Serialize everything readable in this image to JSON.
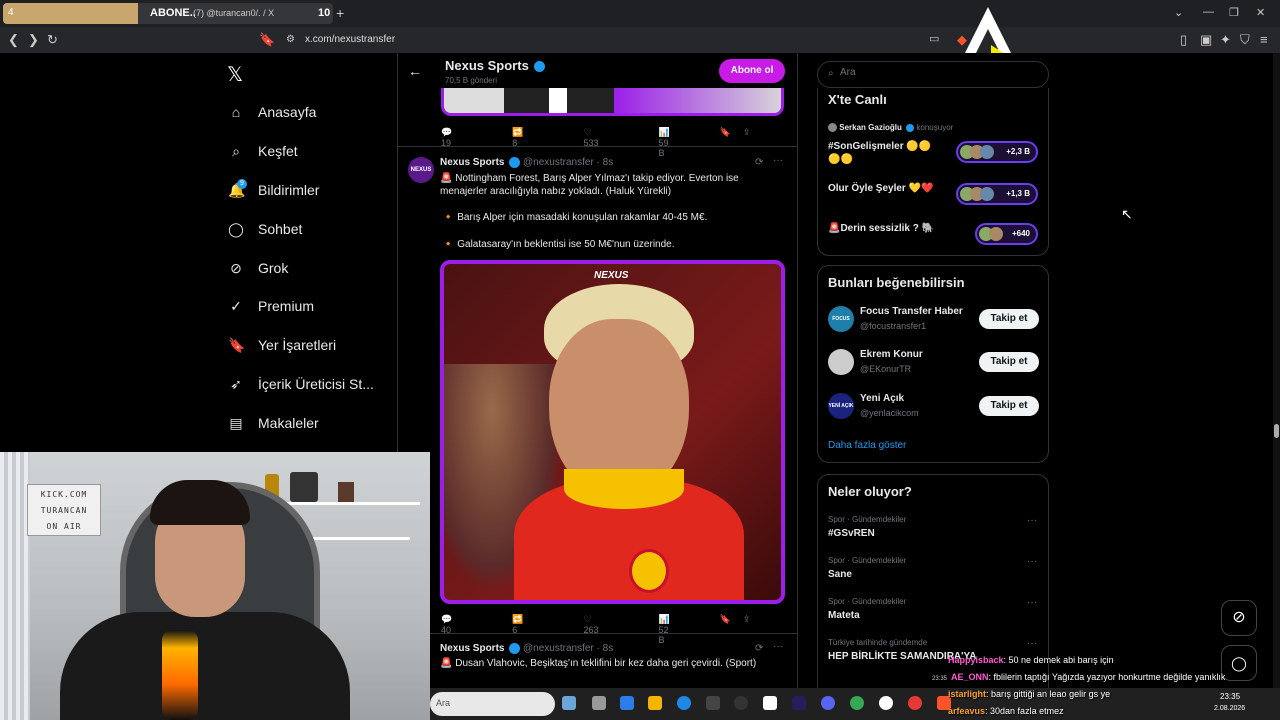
{
  "browser": {
    "tab_number": "4",
    "tab_title": "ABONE..",
    "tab_subtitle": "(7) @turancan0/. / X",
    "tab_count": "10",
    "new_tab": "+",
    "url": "x.com/nexustransfer",
    "tab_progress": 0.41
  },
  "nav": {
    "logo": "𝕏",
    "items": [
      {
        "label": "Anasayfa",
        "icon": "home-icon"
      },
      {
        "label": "Keşfet",
        "icon": "search-icon"
      },
      {
        "label": "Bildirimler",
        "icon": "bell-icon"
      },
      {
        "label": "Sohbet",
        "icon": "chat-icon"
      },
      {
        "label": "Grok",
        "icon": "grok-icon"
      },
      {
        "label": "Premium",
        "icon": "premium-icon"
      },
      {
        "label": "Yer İşaretleri",
        "icon": "bookmark-icon"
      },
      {
        "label": "İçerik Üreticisi St...",
        "icon": "rocket-icon"
      },
      {
        "label": "Makaleler",
        "icon": "article-icon"
      }
    ],
    "notif_badge": "9"
  },
  "profile_header": {
    "name": "Nexus Sports",
    "posts": "70,5 B gönderi",
    "subscribe": "Abone ol"
  },
  "tweet1_actions": {
    "replies": "19",
    "retweets": "8",
    "likes": "533",
    "views": "59 B"
  },
  "tweet2": {
    "name": "Nexus Sports",
    "handle": "@nexustransfer · 8s",
    "text1": "🚨 Nottingham Forest, Barış Alper Yılmaz'ı takip ediyor. Everton ise menajerler aracılığıyla nabız yokladı. (Haluk Yürekli)",
    "bullet1": "🔸 Barış Alper için masadaki konuşulan rakamlar 40-45 M€.",
    "bullet2": "🔸 Galatasaray'ın beklentisi ise 50 M€'nun üzerinde.",
    "image_watermark": "NEXUS",
    "actions": {
      "replies": "40",
      "retweets": "6",
      "likes": "263",
      "views": "52 B"
    }
  },
  "tweet3": {
    "name": "Nexus Sports",
    "handle": "@nexustransfer · 8s",
    "text": "🚨 Dusan Vlahovic, Beşiktaş'ın teklifini bir kez daha geri çevirdi. (Sport)"
  },
  "search": {
    "placeholder": "Ara"
  },
  "live": {
    "title": "X'te Canlı",
    "host": "Serkan Gazioğlu",
    "host_status": "konuşuyor",
    "items": [
      {
        "title": "#SonGelişmeler 🟡🟡🟡🟡",
        "count": "+2,3 B"
      },
      {
        "title": "Olur Öyle Şeyler 💛❤️",
        "count": "+1,3 B"
      },
      {
        "title": "🚨Derin sessizlik ? 🐘",
        "count": "+640"
      }
    ]
  },
  "suggest": {
    "title": "Bunları beğenebilirsin",
    "accounts": [
      {
        "name": "Focus Transfer Haber",
        "handle": "@focustransfer1",
        "button": "Takip et",
        "avatar": "FOCUS"
      },
      {
        "name": "Ekrem Konur",
        "handle": "@EKonurTR",
        "button": "Takip et",
        "avatar": ""
      },
      {
        "name": "Yeni Açık",
        "handle": "@yenlacikcom",
        "button": "Takip et",
        "avatar": "YENİ AÇIK"
      }
    ],
    "more": "Daha fazla göster"
  },
  "trends": {
    "title": "Neler oluyor?",
    "items": [
      {
        "category": "Spor · Gündemdekiler",
        "name": "#GSvREN"
      },
      {
        "category": "Spor · Gündemdekiler",
        "name": "Sane"
      },
      {
        "category": "Spor · Gündemdekiler",
        "name": "Mateta"
      },
      {
        "category": "Türkiye tarihinde gündemde",
        "name": "HEP BİRLİKTE SAMANDIRA'YA"
      }
    ]
  },
  "webcam": {
    "sign_lines": [
      "KICK.COM",
      "TURANCAN",
      "ON AIR"
    ]
  },
  "chat": [
    {
      "time": "",
      "user": "Happyisback",
      "message": ": 50 ne demek abi barış için",
      "color": "#ff5bd1"
    },
    {
      "time": "23:35",
      "user": "AE_ONN",
      "message": ": fblilerin taptığı Yağızda yazıyor honkurtme değilde yanıklık",
      "color": "#ff5bd1"
    },
    {
      "time": "",
      "user": "istarlight",
      "message": ": barış gittiği an leao gelir gs ye",
      "color": "#ff9f2b"
    },
    {
      "time": "",
      "user": "arfeavus",
      "message": ": 30dan fazla etmez",
      "color": "#ff9f2b"
    }
  ],
  "taskbar": {
    "search_placeholder": "Ara",
    "clock_time": "23:35",
    "clock_date": "2.08.2026"
  },
  "colors": {
    "accent_purple": "#9b1fe8",
    "verified_blue": "#1d9bf0",
    "subscribe_bg": "#c81be6",
    "galatasaray_red": "#c8102e",
    "galatasaray_yellow": "#f6c200"
  }
}
